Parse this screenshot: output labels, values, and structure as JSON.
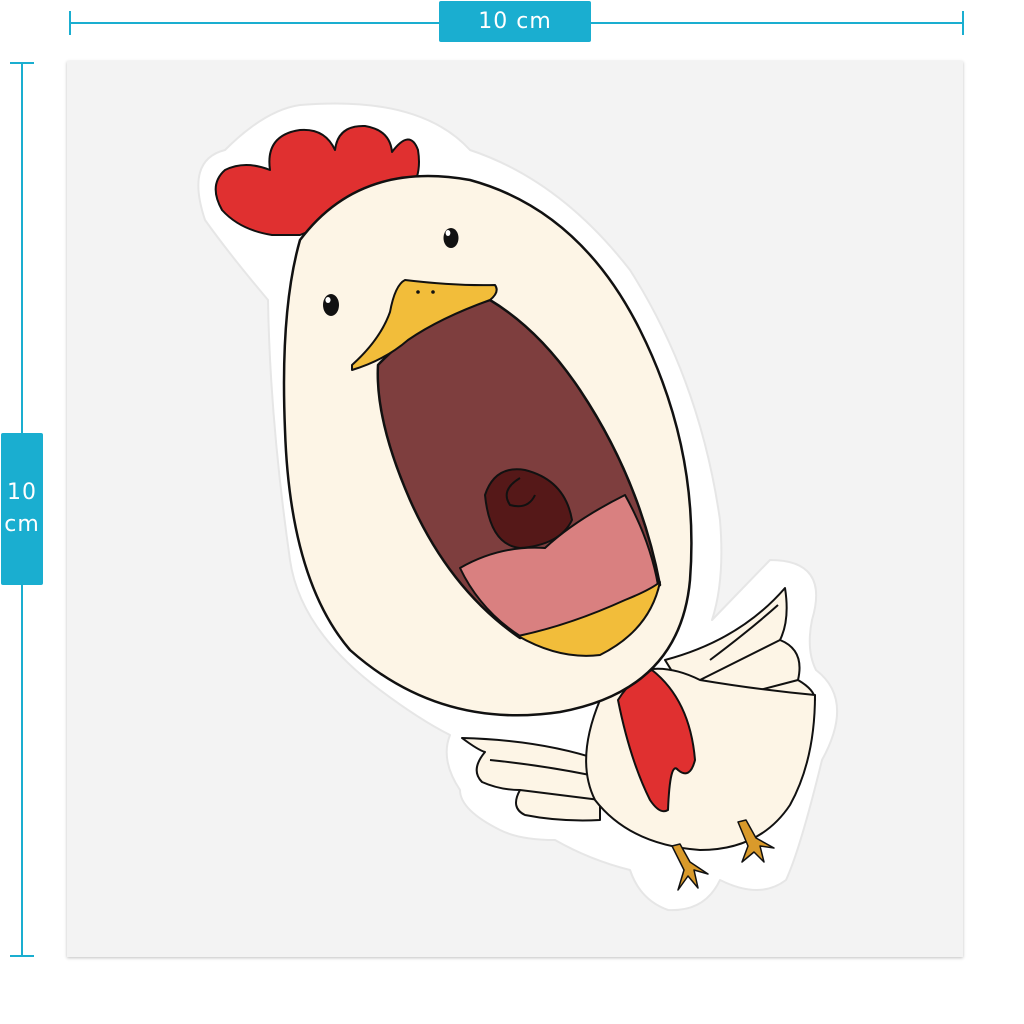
{
  "dimensions": {
    "width_label": "10 cm",
    "height_value": "10",
    "height_unit": "cm"
  },
  "colors": {
    "accent": "#1aaed0",
    "sheet": "#f3f3f3",
    "body": "#fdf5e6",
    "comb": "#e03030",
    "beak": "#f2bd3a",
    "mouth": "#7e3e3e",
    "tongue": "#d98080",
    "throat": "#551818",
    "feet": "#d99a2b"
  },
  "illustration": {
    "subject": "screaming-chicken-sticker"
  }
}
